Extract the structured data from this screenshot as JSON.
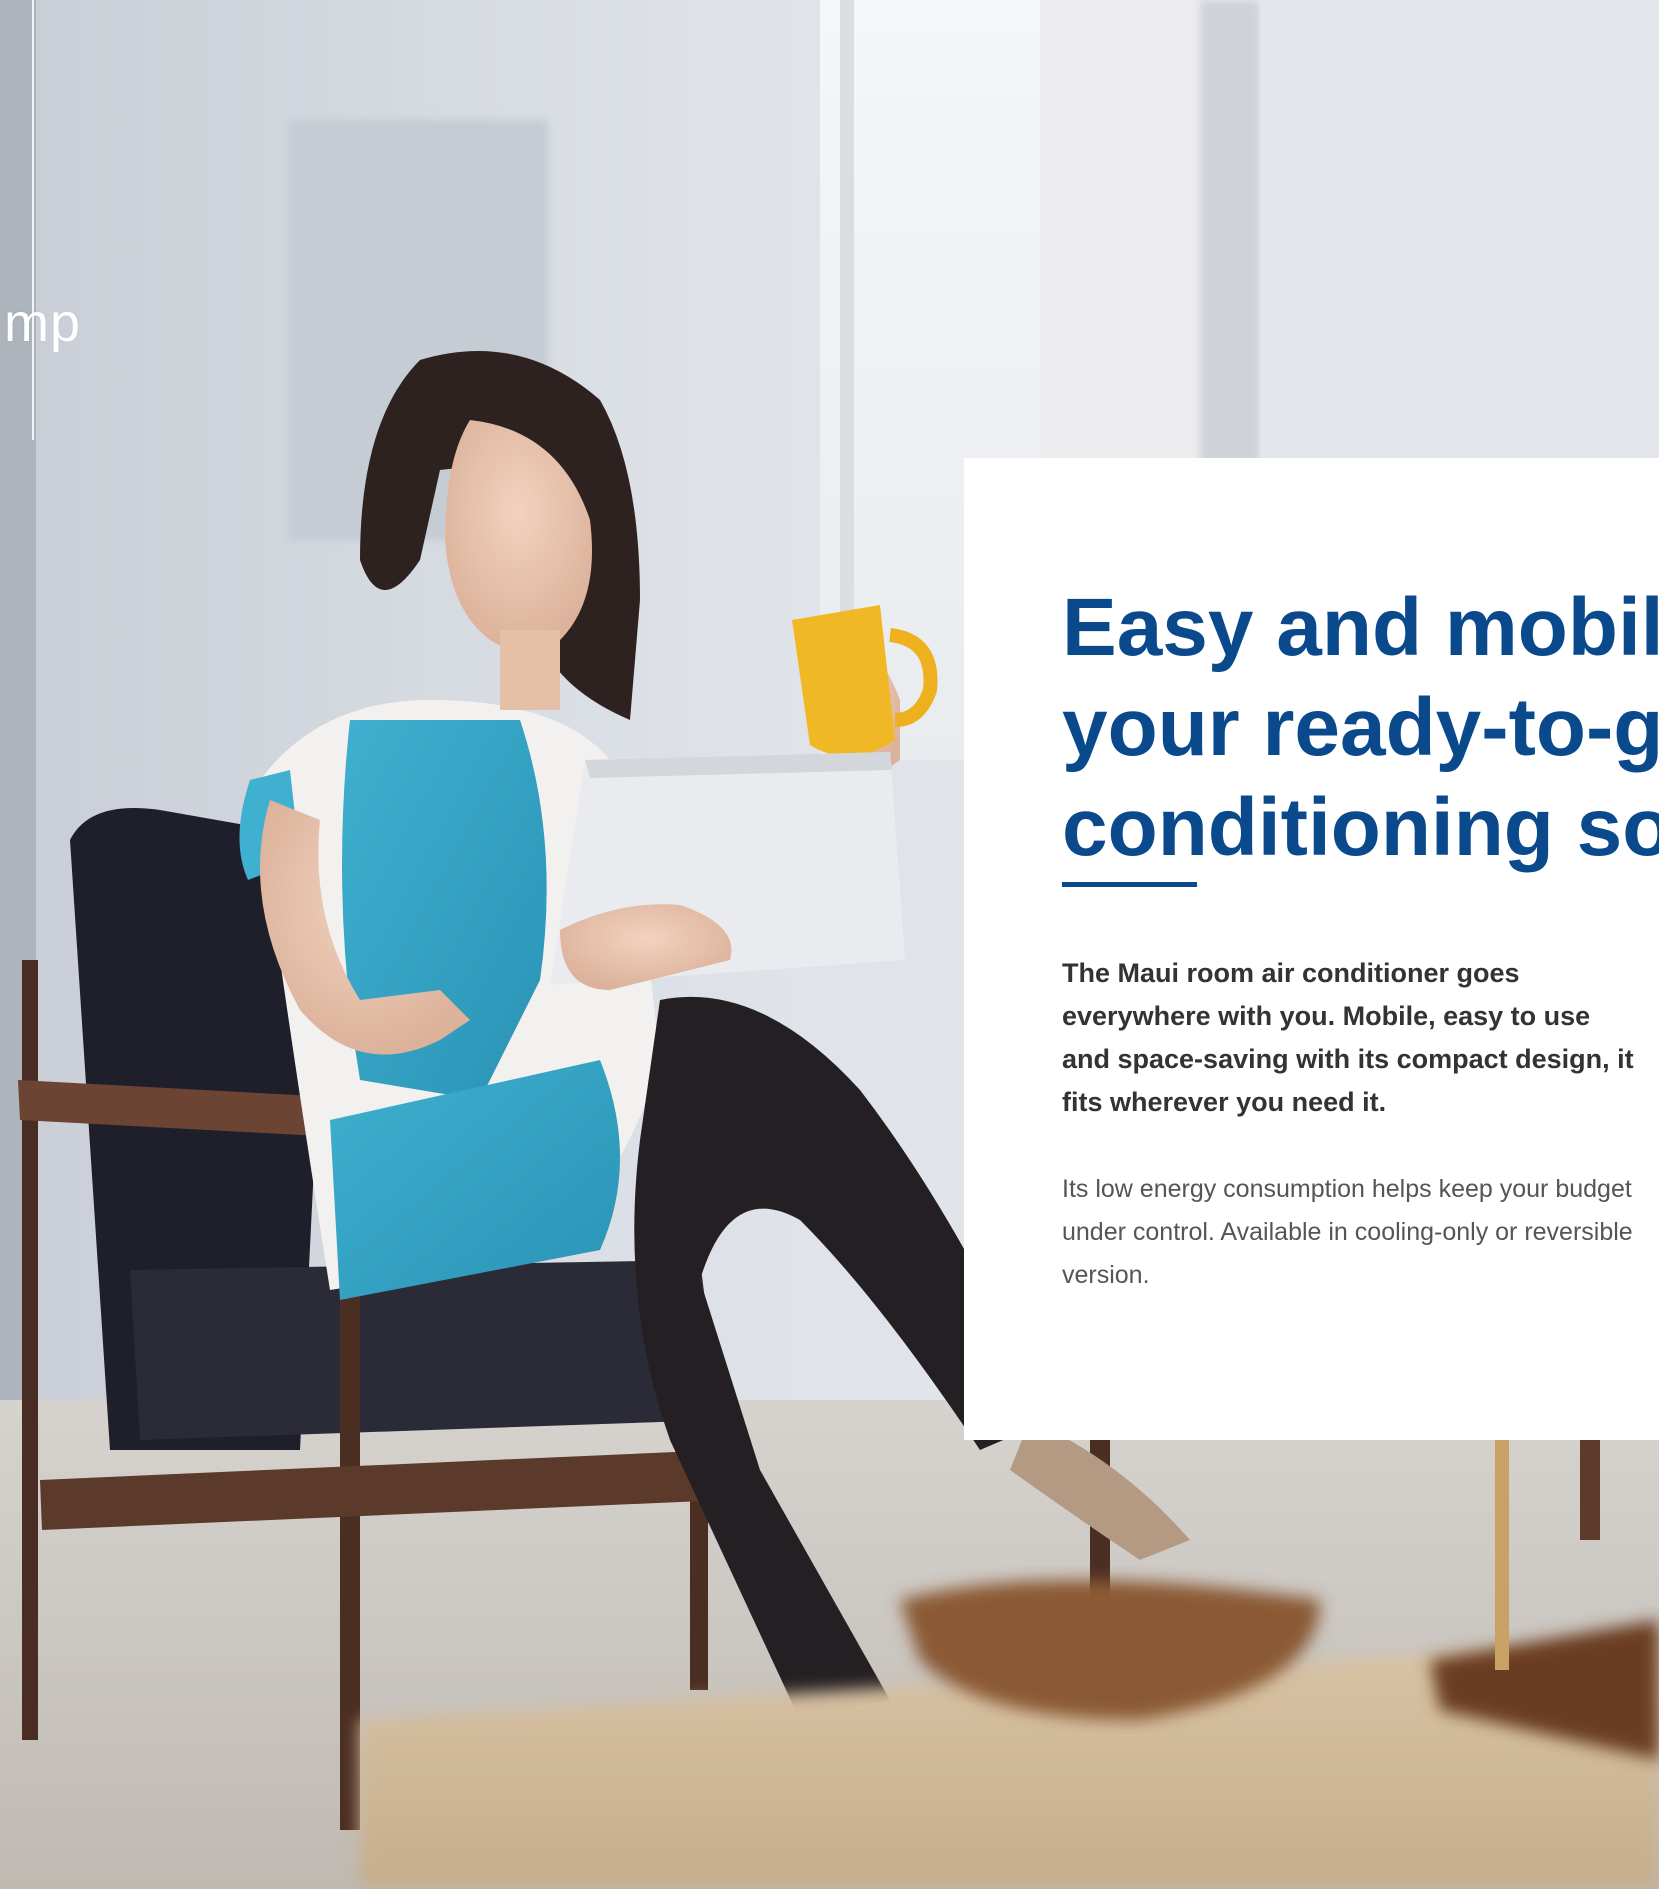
{
  "edge_text": "mp",
  "card": {
    "title_lines": [
      "Easy and mobil",
      "your ready-to-g",
      "conditioning so"
    ],
    "lead": "The Maui room air conditioner goes everywhere with you. Mobile, easy to use and space-saving with its compact design, it fits wherever you need it.",
    "body": "Its low energy consumption helps keep your budget under control. Available in cooling-only or reversible version."
  },
  "colors": {
    "accent": "#0a4a8c",
    "lead_text": "#333333",
    "body_text": "#555555"
  }
}
